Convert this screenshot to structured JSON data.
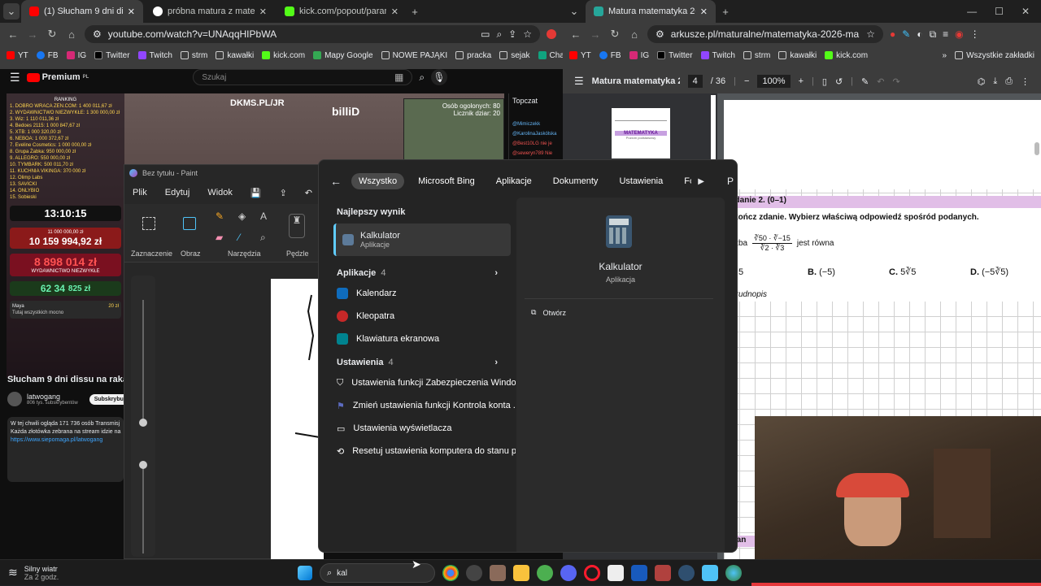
{
  "left_browser": {
    "tabs": [
      {
        "label": "(1) Słucham 9 dni dissu na ..."
      },
      {
        "label": "próbna matura z matematyki 2026"
      },
      {
        "label": "kick.com/popout/paramaxil/ch"
      }
    ],
    "url": "youtube.com/watch?v=UNAqqHIPbWA",
    "bookmarks": [
      "YT",
      "FB",
      "IG",
      "Twitter",
      "Twitch",
      "strm",
      "kawałki",
      "kick.com",
      "Mapy Google",
      "NOWE PAJĄKI",
      "pracka",
      "sejak",
      "Chat"
    ]
  },
  "youtube": {
    "premium_label": "Premium",
    "region": "PL",
    "search_placeholder": "Szukaj",
    "stream_site": "DKMS.PL/JR",
    "overlay_name": "billiD",
    "viewer_count": "Osób ogolonych: 80",
    "viewer_count_2": "Licznik dziar: 20",
    "ranking_title": "RANKING",
    "ranking": [
      "1. DOBRO WRACA ZEN.COM: 1 400 011,67 zł",
      "2. WYDAWNICTWO NIEZWYKŁE: 1 300 000,00 zł",
      "3. Wiz: 1 110 011,36 zł",
      "4. Bedoes 2115: 1 000 847,67 zł",
      "5. XTB: 1 000 320,00 zł",
      "6. NEBOA: 1 000 372,67 zł",
      "7. Eveline Cosmetics: 1 000 000,00 zł",
      "8. Grupa Żabka: 950 000,00 zł",
      "9. ALLEGRO: 550 000,00 zł",
      "10. TYMBARK: 500 011,70 zł",
      "11. KUCHNIA VIKINGA: 370 000 zł",
      "12. Olimp Labs",
      "13. SAVICKI",
      "14. ONLYBIO",
      "15. Sobieski"
    ],
    "timer": "13:10:15",
    "counter1_label": "11 000 000,00 zł",
    "counter1": "10 159 994,92 zł",
    "counter2": "8 898 014 zł",
    "counter2_label": "WYDAWNICTWO NIEZWYKŁE",
    "counter3": "62 34",
    "counter3b": "825 zł",
    "chat_user": "Maya",
    "chat_amount": "20 zł",
    "chat_msg": "Tutaj wszystkich mocno",
    "video_title": "Słucham 9 dni dissu na raka żeb",
    "channel": "latwogang",
    "subs": "806 tys. subskrybentów",
    "subscribe": "Subskrybuj",
    "desc_line1": "W tej chwili ogląda 171 736 osób  Transmisj",
    "desc_line2": "Każda złotówka zebrana na stream idzie na",
    "desc_link": "https://www.siepomaga.pl/latwogang",
    "chat_header": "Topczat",
    "chat_lines": [
      "@Mimiczekk",
      "@KarolinaJaskólska",
      "@Best10LG  nie je",
      "@seweryn789  Nie"
    ]
  },
  "paint": {
    "title": "Bez tytułu - Paint",
    "menu": [
      "Plik",
      "Edytuj",
      "Widok"
    ],
    "groups": [
      "Zaznaczenie",
      "Obraz",
      "Narzędzia",
      "Pędzle"
    ]
  },
  "start_search": {
    "filters": [
      "Wszystko",
      "Microsoft Bing",
      "Aplikacje",
      "Dokumenty",
      "Ustawienia",
      "Foldery"
    ],
    "profile_initial": "P",
    "more": "···",
    "best_label": "Najlepszy wynik",
    "best": {
      "name": "Kalkulator",
      "type": "Aplikacje"
    },
    "apps_label": "Aplikacje",
    "apps_count": "4",
    "apps": [
      "Kalendarz",
      "Kleopatra",
      "Klawiatura ekranowa"
    ],
    "settings_label": "Ustawienia",
    "settings_count": "4",
    "settings": [
      "Ustawienia funkcji Zabezpieczenia Windo...",
      "Zmień ustawienia funkcji Kontrola konta ...",
      "Ustawienia wyświetlacza",
      "Resetuj ustawienia komputera do stanu p..."
    ],
    "preview": {
      "name": "Kalkulator",
      "type": "Aplikacja",
      "action": "Otwórz"
    }
  },
  "right_browser": {
    "tab": "Matura matematyka 2026 marze",
    "url": "arkusze.pl/maturalne/matematyka-2026-marzec-probna...",
    "bookmarks": [
      "YT",
      "FB",
      "IG",
      "Twitter",
      "Twitch",
      "strm",
      "kawałki",
      "kick.com"
    ],
    "all_bookmarks": "Wszystkie zakładki"
  },
  "pdf": {
    "title": "Matura matematyka 2...",
    "page": "4",
    "pages": "/ 36",
    "zoom": "100%",
    "thumb_title": "MATEMATYKA",
    "thumb_sub": "Poziom podstawowy",
    "task_title": "adanie 2. (0–1)",
    "instruction": "okończ zdanie. Wybierz właściwą odpowiedź spośród podanych.",
    "expr_prefix": "czba",
    "expr_num": "∛50 · ∛−15",
    "expr_den": "∛2 · ∛3",
    "expr_suffix": "jest równa",
    "answers": [
      {
        "letter": "",
        "text": "5"
      },
      {
        "letter": "B.",
        "text": "(−5)"
      },
      {
        "letter": "C.",
        "text": "5∛5"
      },
      {
        "letter": "D.",
        "text": "(−5∛5)"
      }
    ],
    "scratch": "Brudnopis",
    "task3_fragment": "adan"
  },
  "taskbar": {
    "weather": "Silny wiatr",
    "weather_time": "Za 2 godz.",
    "search_text": "kal",
    "colors": {
      "accent": "#0078d4"
    }
  }
}
